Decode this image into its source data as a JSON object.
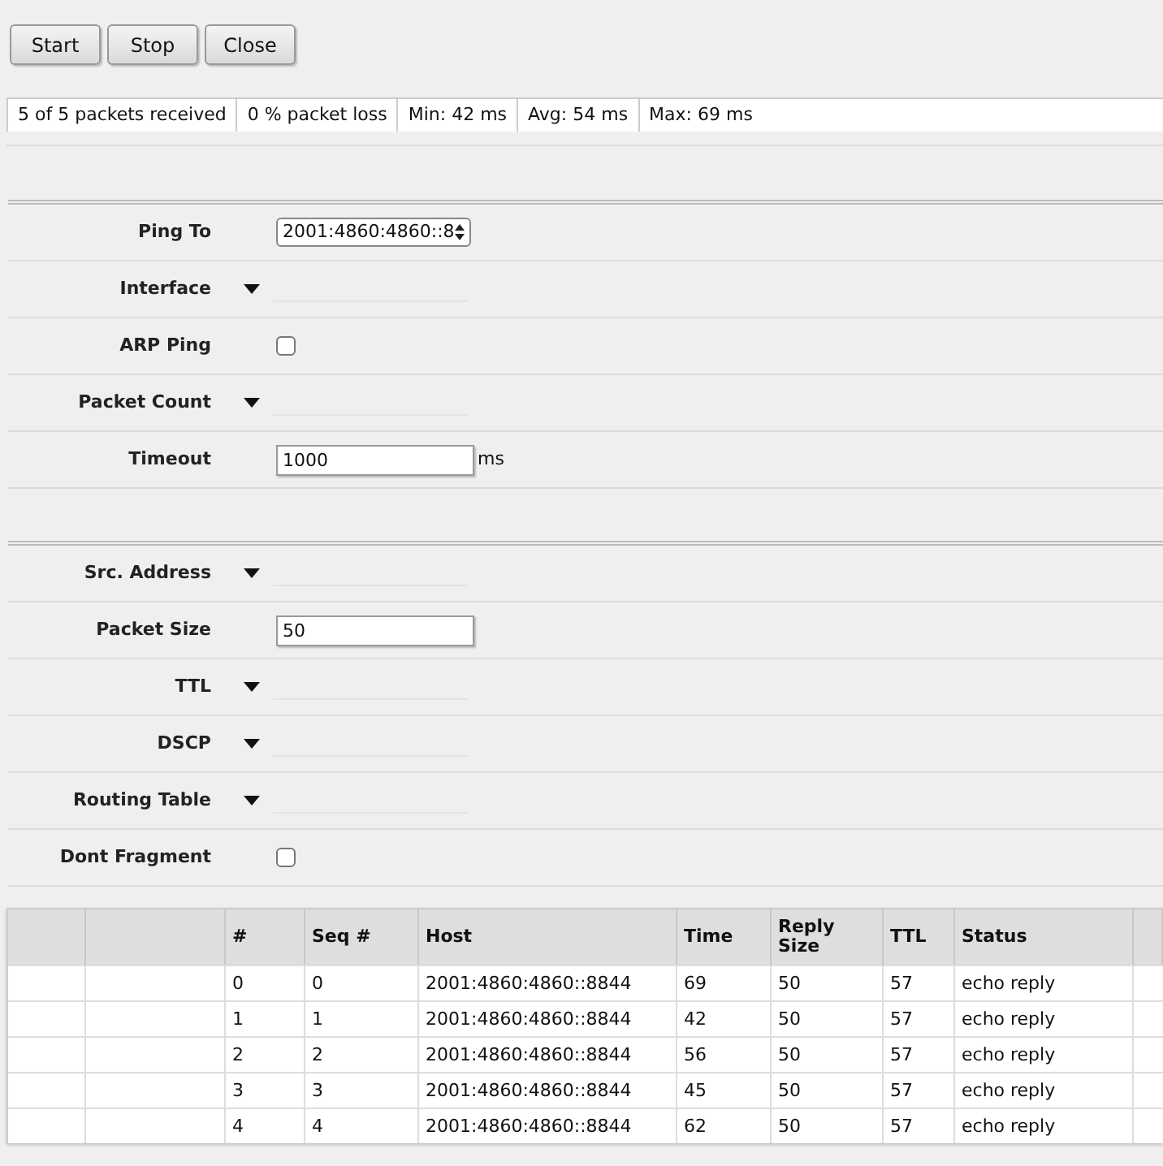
{
  "buttons": [
    "Start",
    "Stop",
    "Close"
  ],
  "status_bar": [
    "5 of 5 packets received",
    "0 % packet loss",
    "Min: 42 ms",
    "Avg: 54 ms",
    "Max: 69 ms"
  ],
  "sections": [
    {
      "fields": [
        {
          "kind": "select",
          "label": "Ping To",
          "value": "2001:4860:4860::8"
        },
        {
          "kind": "dropdown",
          "label": "Interface"
        },
        {
          "kind": "checkbox",
          "label": "ARP Ping",
          "checked": false
        },
        {
          "kind": "dropdown",
          "label": "Packet Count"
        },
        {
          "kind": "input",
          "label": "Timeout",
          "value": "1000",
          "unit": "ms"
        }
      ]
    },
    {
      "fields": [
        {
          "kind": "dropdown",
          "label": "Src. Address"
        },
        {
          "kind": "input",
          "label": "Packet Size",
          "value": "50"
        },
        {
          "kind": "dropdown",
          "label": "TTL"
        },
        {
          "kind": "dropdown",
          "label": "DSCP"
        },
        {
          "kind": "dropdown",
          "label": "Routing Table"
        },
        {
          "kind": "checkbox",
          "label": "Dont Fragment",
          "checked": false
        }
      ]
    }
  ],
  "table": {
    "columns": [
      "#",
      "Seq #",
      "Host",
      "Time",
      "Reply Size",
      "TTL",
      "Status"
    ],
    "rows": [
      [
        "0",
        "0",
        "2001:4860:4860::8844",
        "69",
        "50",
        "57",
        "echo reply"
      ],
      [
        "1",
        "1",
        "2001:4860:4860::8844",
        "42",
        "50",
        "57",
        "echo reply"
      ],
      [
        "2",
        "2",
        "2001:4860:4860::8844",
        "56",
        "50",
        "57",
        "echo reply"
      ],
      [
        "3",
        "3",
        "2001:4860:4860::8844",
        "45",
        "50",
        "57",
        "echo reply"
      ],
      [
        "4",
        "4",
        "2001:4860:4860::8844",
        "62",
        "50",
        "57",
        "echo reply"
      ]
    ]
  }
}
